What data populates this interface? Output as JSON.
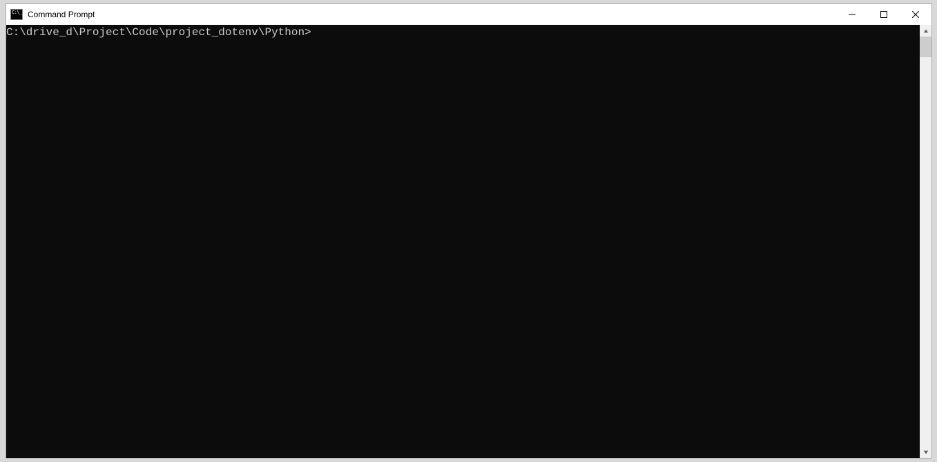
{
  "window": {
    "title": "Command Prompt"
  },
  "terminal": {
    "prompt": "C:\\drive_d\\Project\\Code\\project_dotenv\\Python>"
  },
  "colors": {
    "terminal_bg": "#0c0c0c",
    "terminal_fg": "#cccccc",
    "titlebar_bg": "#ffffff",
    "scrollbar_bg": "#f0f0f0",
    "scrollbar_thumb": "#cdcdcd"
  }
}
